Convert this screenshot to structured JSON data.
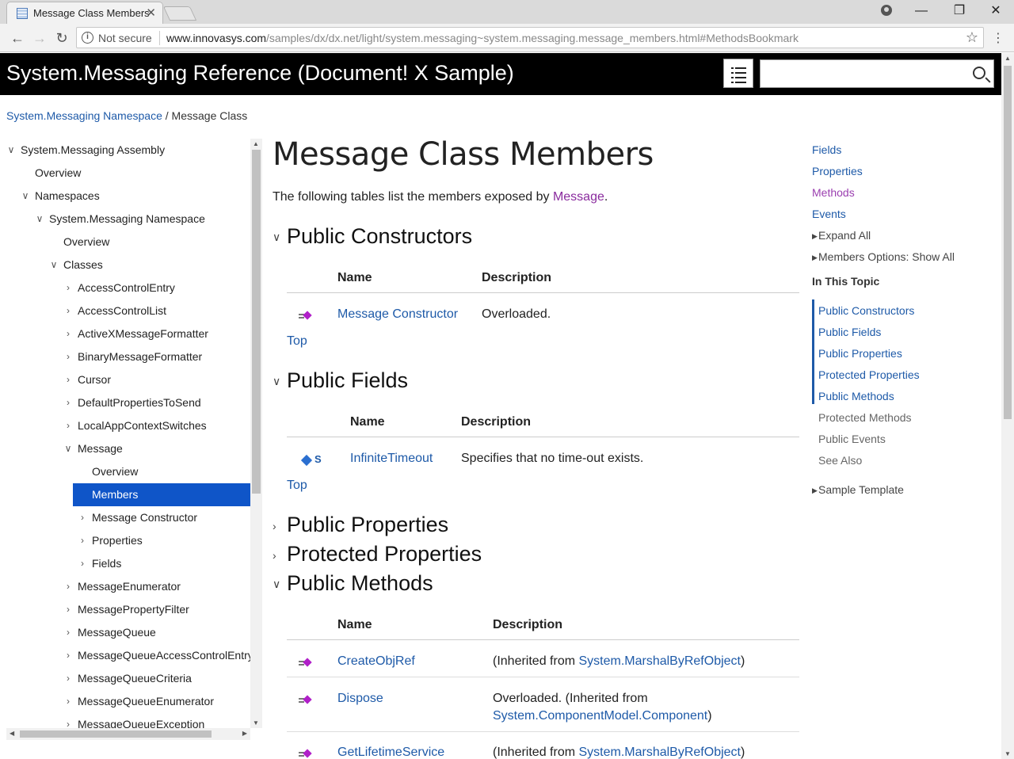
{
  "browser": {
    "tab_title": "Message Class Members",
    "tab_close": "✕",
    "not_secure": "Not secure",
    "url_host": "www.innovasys.com",
    "url_path": "/samples/dx/dx.net/light/system.messaging~system.messaging.message_members.html#MethodsBookmark",
    "back": "←",
    "forward": "→",
    "reload": "↻",
    "star": "☆",
    "menu": "⋮",
    "minimize": "—",
    "maximize": "❐",
    "close": "✕"
  },
  "header": {
    "title": "System.Messaging Reference (Document! X Sample)",
    "search_placeholder": ""
  },
  "breadcrumb": {
    "link": "System.Messaging Namespace",
    "separator": " / ",
    "current": "Message Class"
  },
  "tree": [
    {
      "label": "System.Messaging Assembly",
      "chev": "∨"
    },
    {
      "label": "Overview",
      "chev": ""
    },
    {
      "label": "Namespaces",
      "chev": "∨"
    },
    {
      "label": "System.Messaging Namespace",
      "chev": "∨"
    },
    {
      "label": "Overview",
      "chev": ""
    },
    {
      "label": "Classes",
      "chev": "∨"
    },
    {
      "label": "AccessControlEntry",
      "chev": "›"
    },
    {
      "label": "AccessControlList",
      "chev": "›"
    },
    {
      "label": "ActiveXMessageFormatter",
      "chev": "›"
    },
    {
      "label": "BinaryMessageFormatter",
      "chev": "›"
    },
    {
      "label": "Cursor",
      "chev": "›"
    },
    {
      "label": "DefaultPropertiesToSend",
      "chev": "›"
    },
    {
      "label": "LocalAppContextSwitches",
      "chev": "›"
    },
    {
      "label": "Message",
      "chev": "∨"
    },
    {
      "label": "Overview",
      "chev": ""
    },
    {
      "label": "Members",
      "chev": ""
    },
    {
      "label": "Message Constructor",
      "chev": "›"
    },
    {
      "label": "Properties",
      "chev": "›"
    },
    {
      "label": "Fields",
      "chev": "›"
    },
    {
      "label": "MessageEnumerator",
      "chev": "›"
    },
    {
      "label": "MessagePropertyFilter",
      "chev": "›"
    },
    {
      "label": "MessageQueue",
      "chev": "›"
    },
    {
      "label": "MessageQueueAccessControlEntry",
      "chev": "›"
    },
    {
      "label": "MessageQueueCriteria",
      "chev": "›"
    },
    {
      "label": "MessageQueueEnumerator",
      "chev": "›"
    },
    {
      "label": "MessageQueueException",
      "chev": "›"
    }
  ],
  "main": {
    "title": "Message Class Members",
    "intro_prefix": "The following tables list the members exposed by ",
    "intro_link": "Message",
    "intro_suffix": ".",
    "col_name": "Name",
    "col_desc": "Description",
    "top_label": "Top",
    "sections": {
      "public_constructors": "Public Constructors",
      "public_fields": "Public Fields",
      "public_properties": "Public Properties",
      "protected_properties": "Protected Properties",
      "public_methods": "Public Methods"
    },
    "chev_open": "∨",
    "chev_closed": "›",
    "constructors": [
      {
        "name": "Message Constructor",
        "desc": "Overloaded."
      }
    ],
    "fields": [
      {
        "static": "S",
        "name": "InfiniteTimeout",
        "desc": "Specifies that no time-out exists."
      }
    ],
    "methods": [
      {
        "name": "CreateObjRef",
        "desc_prefix": "(Inherited from ",
        "desc_link": "System.MarshalByRefObject",
        "desc_suffix": ")"
      },
      {
        "name": "Dispose",
        "desc_line1": "Overloaded.  (Inherited from",
        "desc_link": "System.ComponentModel.Component",
        "desc_suffix": ")"
      },
      {
        "name": "GetLifetimeService",
        "desc_prefix": "(Inherited from ",
        "desc_link": "System.MarshalByRefObject",
        "desc_suffix": ")"
      }
    ]
  },
  "rail": {
    "links": [
      {
        "label": "Fields",
        "visited": false
      },
      {
        "label": "Properties",
        "visited": false
      },
      {
        "label": "Methods",
        "visited": true
      },
      {
        "label": "Events",
        "visited": false
      }
    ],
    "expand_all": "Expand All",
    "members_options": "Members Options: Show All",
    "in_this_topic": "In This Topic",
    "topics": [
      {
        "label": "Public Constructors",
        "active": true
      },
      {
        "label": "Public Fields",
        "active": true
      },
      {
        "label": "Public Properties",
        "active": true
      },
      {
        "label": "Protected Properties",
        "active": true
      },
      {
        "label": "Public Methods",
        "active": true
      },
      {
        "label": "Protected Methods",
        "active": false
      },
      {
        "label": "Public Events",
        "active": false
      },
      {
        "label": "See Also",
        "active": false
      }
    ],
    "sample_template": "Sample Template"
  },
  "colors": {
    "link": "#1e5aa8",
    "visited": "#9b3fb0",
    "selected_bg": "#0f55c8",
    "header_bg": "#000000"
  }
}
